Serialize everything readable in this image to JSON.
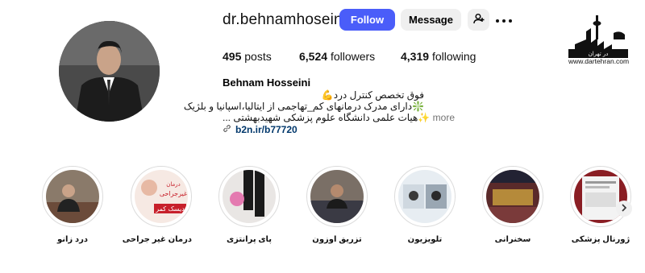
{
  "profile": {
    "username": "dr.behnamhoseini",
    "follow_label": "Follow",
    "message_label": "Message",
    "posts_count": "495",
    "posts_label": "posts",
    "followers_count": "6,524",
    "followers_label": "followers",
    "following_count": "4,319",
    "following_label": "following"
  },
  "bio": {
    "name": "Behnam Hosseini",
    "line1": "فوق تخصص کنترل درد💪",
    "line2": "❇️دارای مدرک درمانهای کم_تهاجمی از ایتالیا،اسپانیا و بلژیک",
    "line3": "✨هیات علمی دانشگاه علوم پزشکی شهیدبهشتی ...",
    "more_label": "more",
    "link": "b2n.ir/b77720"
  },
  "logo": {
    "text": "در تهران",
    "url": "www.dartehran.com"
  },
  "highlights": [
    {
      "label": "درد زانو"
    },
    {
      "label": "درمان غیر جراحی"
    },
    {
      "label": "پای پرانتزی"
    },
    {
      "label": "تزریق اوزون"
    },
    {
      "label": "تلویزیون"
    },
    {
      "label": "سخنرانی"
    },
    {
      "label": "ژورنال پزشکی"
    }
  ],
  "highlight_card_text": {
    "top": "درمان",
    "middle": "غیرجراحی",
    "bottom": "دیسک کمر"
  },
  "colors": {
    "follow_button": "#4a5df9",
    "secondary_button": "#efefef",
    "link": "#00376b"
  }
}
